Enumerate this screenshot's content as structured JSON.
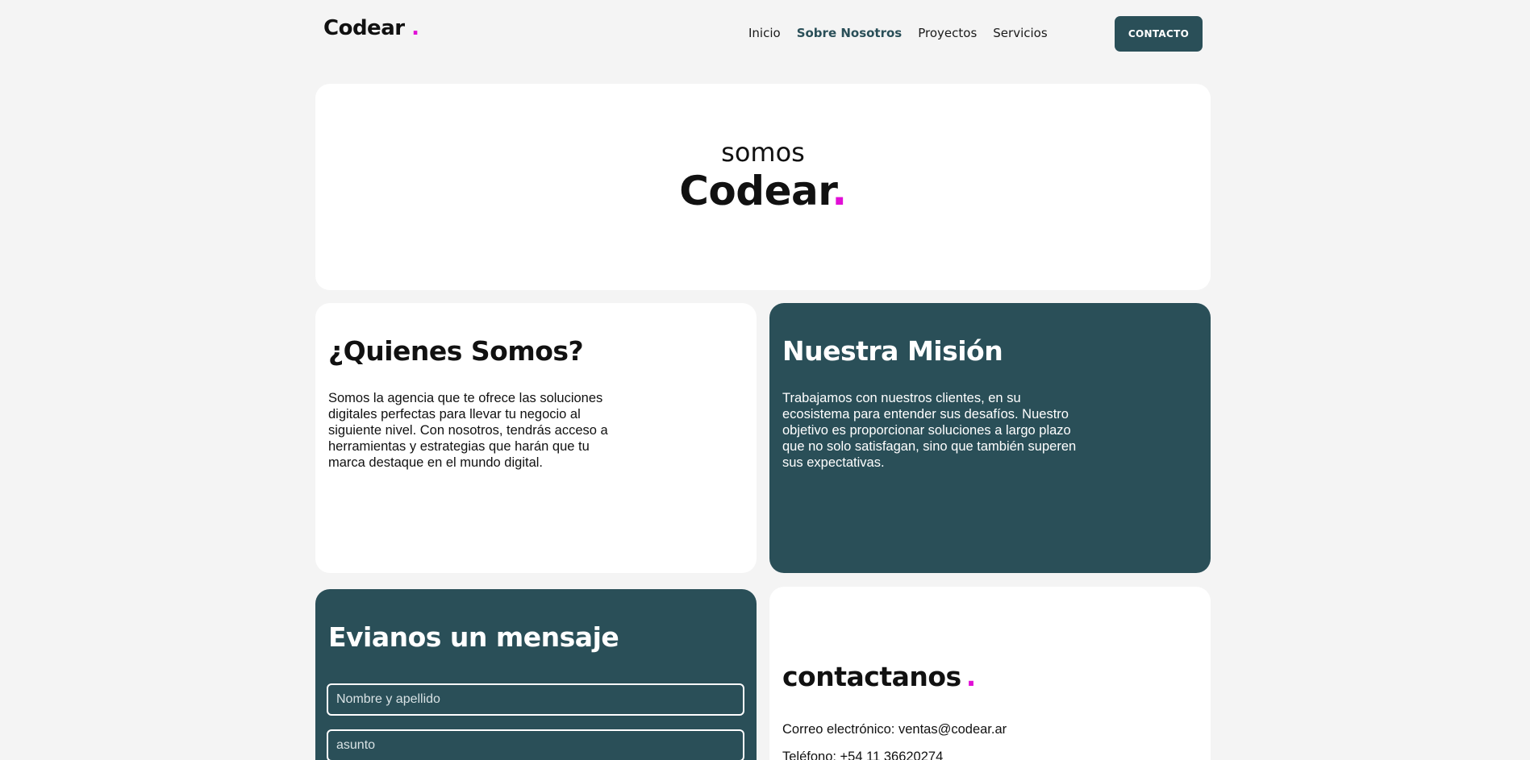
{
  "header": {
    "logo_text": "Codear",
    "logo_dot": ".",
    "nav": [
      "Inicio",
      "Sobre Nosotros",
      "Proyectos",
      "Servicios"
    ],
    "active_nav": "Sobre Nosotros",
    "contact_button": "CONTACTO"
  },
  "hero": {
    "small": "somos",
    "big": "Codear",
    "dot": "."
  },
  "quienes": {
    "title": "¿Quienes Somos?",
    "text": "Somos la agencia que te ofrece las soluciones digitales perfectas para llevar tu negocio al siguiente nivel. Con nosotros, tendrás acceso a herramientas y estrategias que harán que tu marca destaque en el mundo digital."
  },
  "mision": {
    "title": "Nuestra Misión",
    "text": "Trabajamos con nuestros clientes, en su ecosistema para entender sus desafíos. Nuestro objetivo es proporcionar soluciones a largo plazo que no solo satisfagan, sino que también superen sus expectativas."
  },
  "mensaje": {
    "title": "Evianos un mensaje",
    "name_placeholder": "Nombre y apellido",
    "subject_placeholder": "asunto"
  },
  "contacto": {
    "title": "contactanos",
    "dot": ".",
    "email": "Correo electrónico: ventas@codear.ar",
    "phone": "Teléfono: +54 11 36620274"
  },
  "colors": {
    "accent": "#e10fd6",
    "brand": "#2a4f58",
    "background": "#f4f4f4",
    "card": "#ffffff"
  }
}
